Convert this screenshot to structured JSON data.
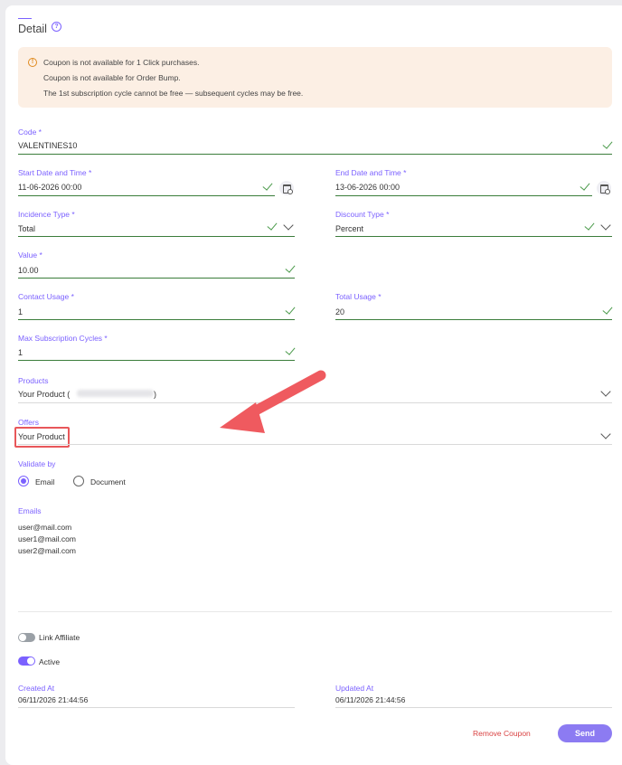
{
  "section": {
    "title": "Detail"
  },
  "alert": {
    "lines": [
      "Coupon is not available for 1 Click purchases.",
      "Coupon is not available for Order Bump.",
      "The 1st subscription cycle cannot be free — subsequent cycles may be free."
    ]
  },
  "fields": {
    "code": {
      "label": "Code *",
      "value": "VALENTINES10"
    },
    "start_date": {
      "label": "Start Date and Time *",
      "value": "11-06-2026 00:00"
    },
    "end_date": {
      "label": "End Date and Time *",
      "value": "13-06-2026 00:00"
    },
    "incidence_type": {
      "label": "Incidence Type *",
      "value": "Total"
    },
    "discount_type": {
      "label": "Discount Type *",
      "value": "Percent"
    },
    "value": {
      "label": "Value *",
      "value": "10.00"
    },
    "contact_usage": {
      "label": "Contact Usage *",
      "value": "1"
    },
    "total_usage": {
      "label": "Total Usage *",
      "value": "20"
    },
    "max_cycles": {
      "label": "Max Subscription Cycles *",
      "value": "1"
    },
    "products": {
      "label": "Products",
      "value_prefix": "Your Product (",
      "value_suffix": ")"
    },
    "offers": {
      "label": "Offers",
      "value": "Your Product"
    }
  },
  "validate_by": {
    "label": "Validate by",
    "options": [
      "Email",
      "Document"
    ],
    "selected": "Email"
  },
  "emails": {
    "label": "Emails",
    "items": [
      "user@mail.com",
      "user1@mail.com",
      "user2@mail.com"
    ]
  },
  "toggles": {
    "link_affiliate": {
      "label": "Link Affiliate",
      "on": false
    },
    "active": {
      "label": "Active",
      "on": true
    }
  },
  "meta": {
    "created_label": "Created At",
    "created_value": "06/11/2026 21:44:56",
    "updated_label": "Updated At",
    "updated_value": "06/11/2026 21:44:56"
  },
  "actions": {
    "remove_label": "Remove Coupon",
    "send_label": "Send"
  },
  "colors": {
    "accent": "#7b61ff",
    "valid": "#3b7d3b",
    "danger": "#d94242",
    "arrow": "#ef5a5f"
  }
}
